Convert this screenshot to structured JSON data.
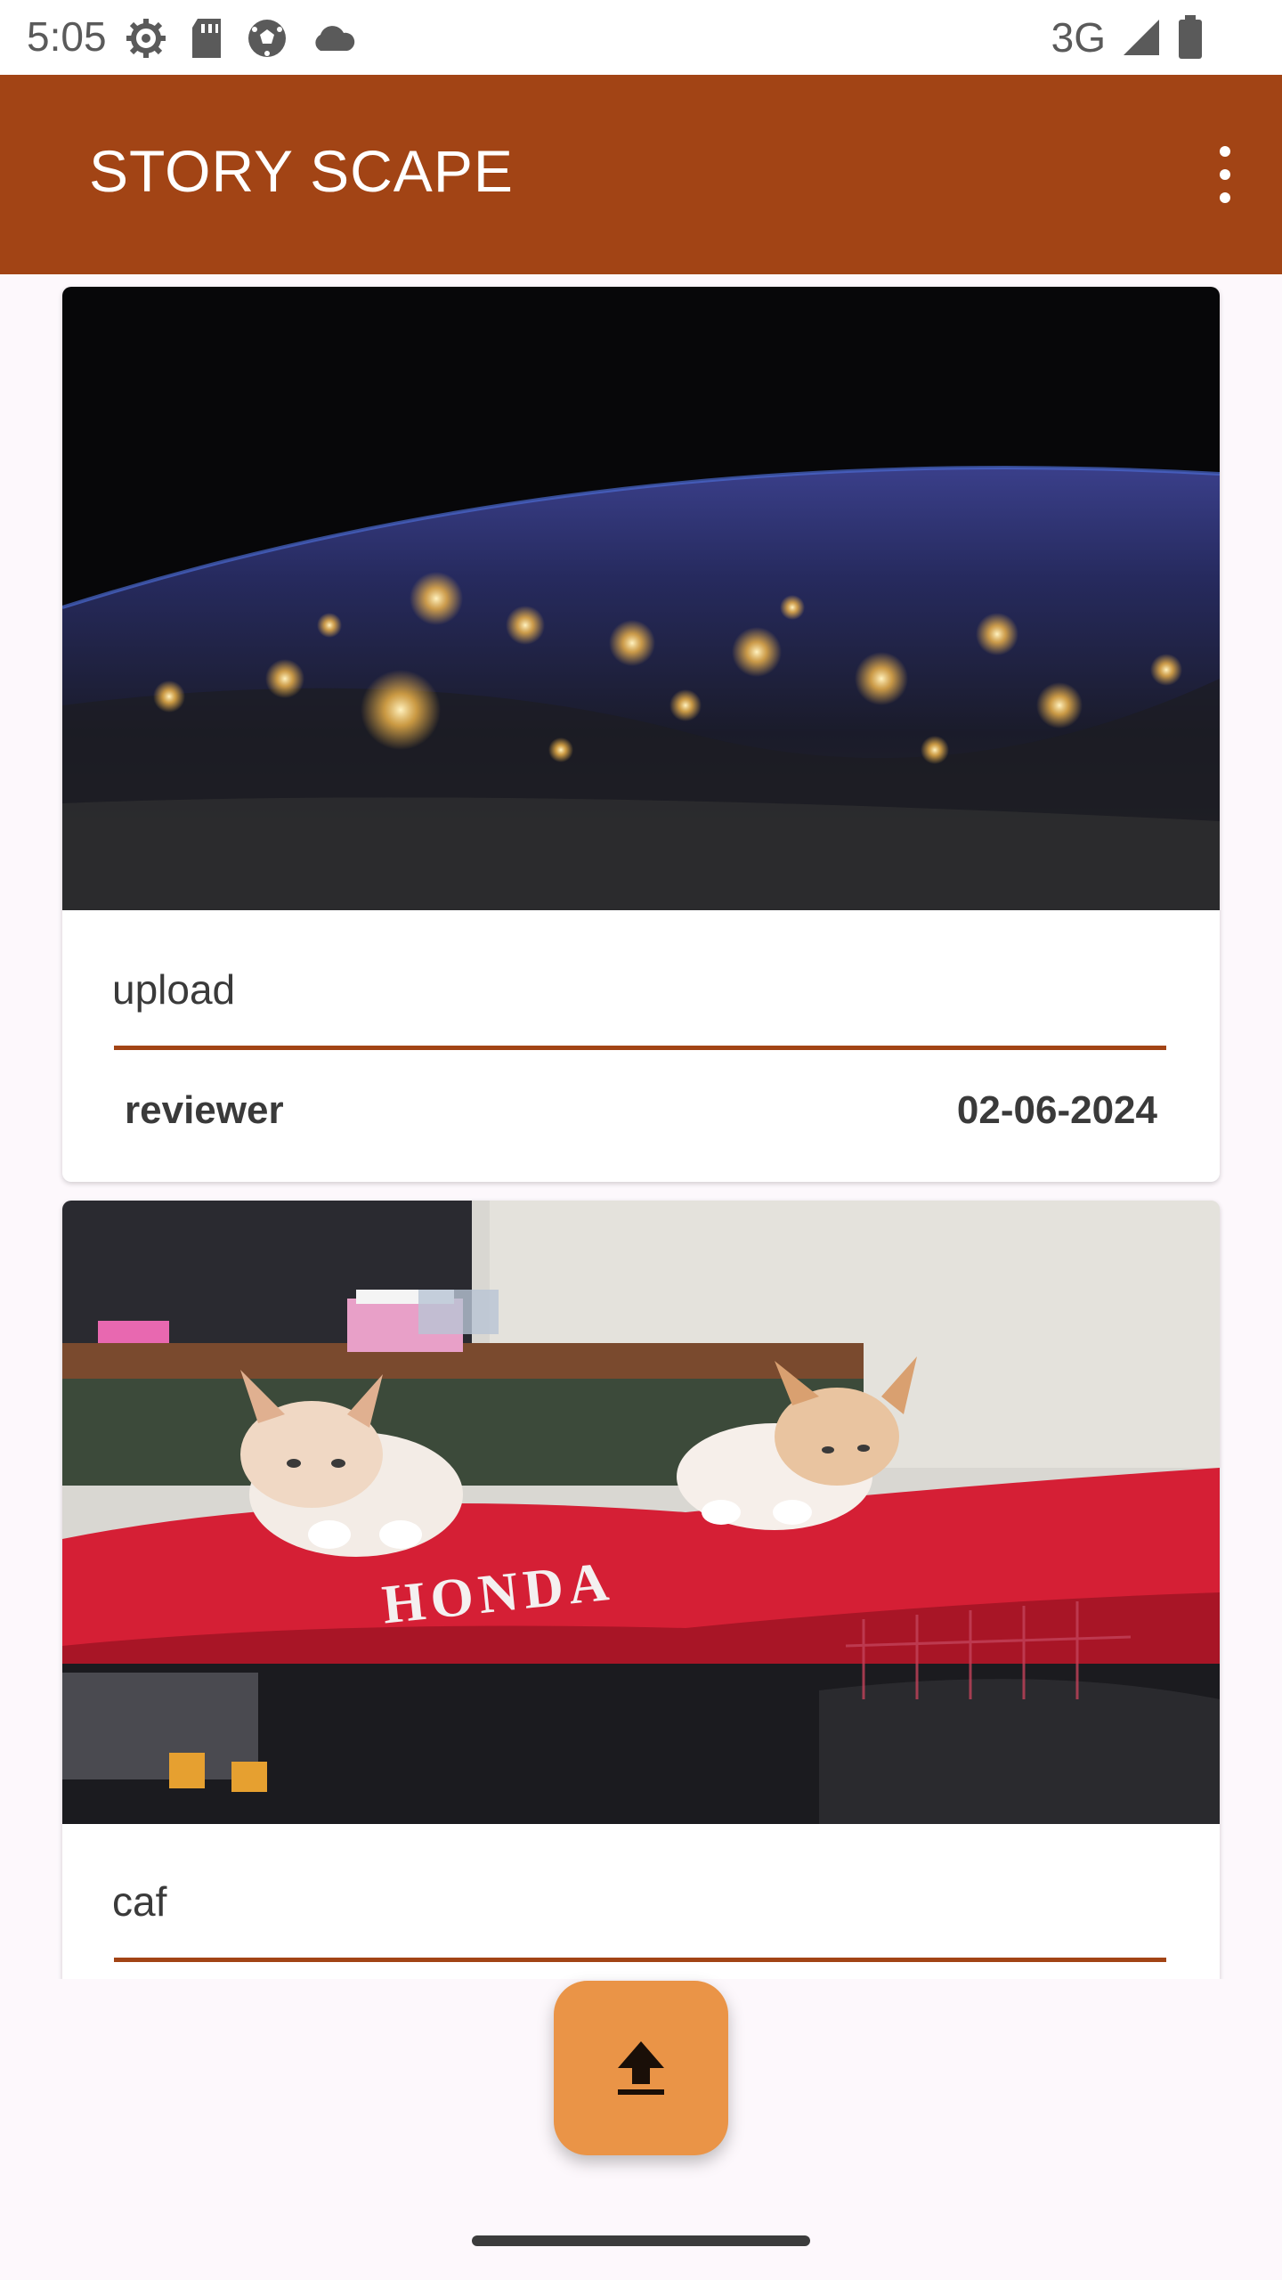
{
  "status_bar": {
    "time": "5:05",
    "network": "3G",
    "left_icons": [
      "settings-icon",
      "sd-card-icon",
      "soccer-ball-icon",
      "cloud-icon"
    ],
    "right_icons": [
      "signal-icon",
      "battery-icon"
    ]
  },
  "app_bar": {
    "title": "STORY SCAPE",
    "menu_icon": "more-vert-icon",
    "color": "#a24415"
  },
  "stories": [
    {
      "image": "earth-at-night-photo",
      "description": "upload",
      "user": "reviewer",
      "date": "02-06-2024"
    },
    {
      "image": "kittens-on-honda-motorcycle-photo",
      "description": "caf"
    }
  ],
  "fab": {
    "icon": "upload-icon",
    "color": "#ea9447"
  },
  "photo_texts": {
    "motorcycle_brand": "HONDA"
  }
}
